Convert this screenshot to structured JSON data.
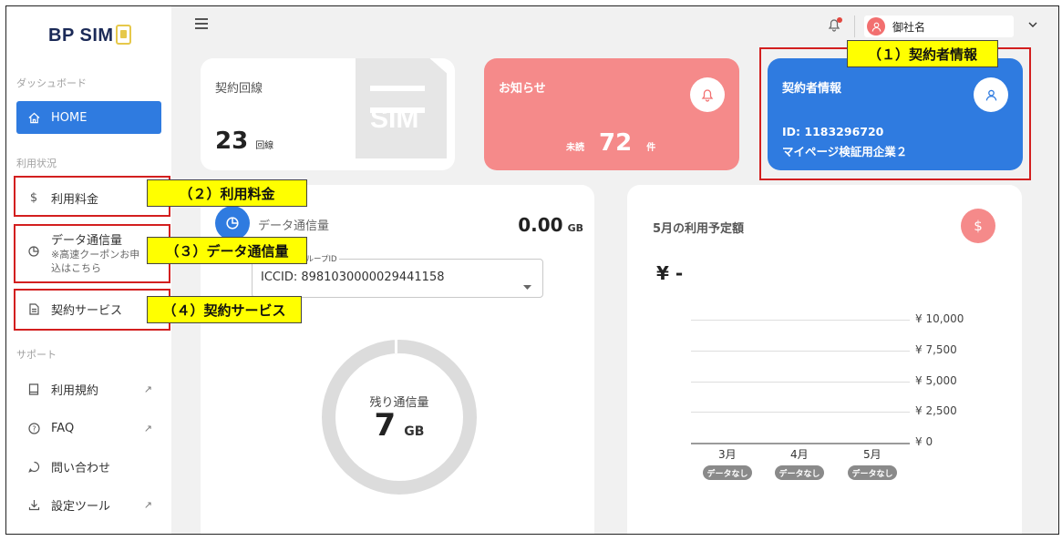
{
  "logo": "BP SIM",
  "sidebar": {
    "section_dashboard": "ダッシュボード",
    "home": "HOME",
    "section_usage": "利用状況",
    "fees": "利用料金",
    "data_usage": "データ通信量",
    "data_usage_sub": "※高速クーポンお申込はこちら",
    "contract_service": "契約サービス",
    "section_support": "サポート",
    "terms": "利用規約",
    "faq": "FAQ",
    "contact": "問い合わせ",
    "settings_tool": "設定ツール"
  },
  "topbar": {
    "user_name": "御社名"
  },
  "cards": {
    "lines": {
      "title": "契約回線",
      "count": "23",
      "unit": "回線"
    },
    "news": {
      "title": "お知らせ",
      "unread_label": "未読",
      "count": "72",
      "unit": "件"
    },
    "contractor": {
      "title": "契約者情報",
      "id_line": "ID: 1183296720",
      "company": "マイページ検証用企業２"
    }
  },
  "data_panel": {
    "title": "データ通信量",
    "amount": "0.00",
    "amount_unit": "GB",
    "select_label": "グループID",
    "select_value": "ICCID: 8981030000029441158",
    "donut_label": "残り通信量",
    "remaining_value": "7",
    "remaining_unit": "GB"
  },
  "forecast_panel": {
    "title": "5月の利用予定額",
    "amount": "¥ -"
  },
  "chart_data": {
    "type": "bar",
    "categories": [
      "3月",
      "4月",
      "5月"
    ],
    "values": [
      null,
      null,
      null
    ],
    "category_badges": [
      "データなし",
      "データなし",
      "データなし"
    ],
    "yticks": [
      "¥ 10,000",
      "¥ 7,500",
      "¥ 5,000",
      "¥ 2,500",
      "¥ 0"
    ],
    "ylim": [
      0,
      10000
    ],
    "grid": true
  },
  "annotations": {
    "a1": "（１）契約者情報",
    "a2": "（２）利用料金",
    "a3": "（３）データ通信量",
    "a4": "（４）契約サービス"
  },
  "colors": {
    "accent": "#2f7be0",
    "news": "#f58a8a",
    "annotation": "#ffff00",
    "annotation_border": "#d31f1f"
  }
}
